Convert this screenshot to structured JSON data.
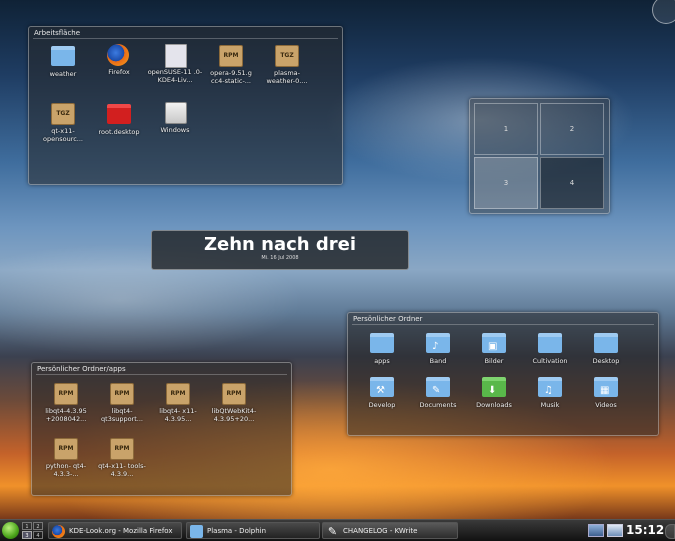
{
  "desktop_panel": {
    "title": "Arbeitsfläche",
    "icons": [
      {
        "label": "weather",
        "icon": "folder-icon"
      },
      {
        "label": "Firefox",
        "icon": "firefox-icon"
      },
      {
        "label": "openSUSE-11 .0-KDE4-Liv...",
        "icon": "cd-image-icon"
      },
      {
        "label": "opera-9.51.g cc4-static-...",
        "icon": "rpm-package-icon",
        "badge": "RPM"
      },
      {
        "label": "plasma- weather-0....",
        "icon": "tgz-archive-icon",
        "badge": "TGZ"
      },
      {
        "label": "qt-x11- opensourc...",
        "icon": "tgz-archive-icon",
        "badge": "TGZ"
      },
      {
        "label": "root.desktop",
        "icon": "red-folder-icon"
      },
      {
        "label": "Windows",
        "icon": "drive-icon"
      }
    ]
  },
  "pager": {
    "desktops": [
      "1",
      "2",
      "3",
      "4"
    ]
  },
  "clock": {
    "time": "Zehn nach drei",
    "date": "Mi. 16 Jul 2008"
  },
  "home_panel": {
    "title": "Persönlicher Ordner",
    "icons": [
      {
        "label": "apps"
      },
      {
        "label": "Band",
        "glyph": "♪"
      },
      {
        "label": "Bilder",
        "glyph": "▣"
      },
      {
        "label": "Cultivation"
      },
      {
        "label": "Desktop"
      },
      {
        "label": "Develop",
        "glyph": "⚒"
      },
      {
        "label": "Documents",
        "glyph": "✎"
      },
      {
        "label": "Downloads",
        "glyph": "⬇"
      },
      {
        "label": "Musik",
        "glyph": "♫"
      },
      {
        "label": "Videos",
        "glyph": "▦"
      }
    ]
  },
  "apps_panel": {
    "title": "Persönlicher Ordner/apps",
    "icons": [
      {
        "label": "libqt4-4.3.95 +2008042...",
        "badge": "RPM"
      },
      {
        "label": "libqt4- qt3support...",
        "badge": "RPM"
      },
      {
        "label": "libqt4- x11-4.3.95...",
        "badge": "RPM"
      },
      {
        "label": "libQtWebKit4- 4.3.95+20...",
        "badge": "RPM"
      },
      {
        "label": "python- qt4-4.3.3-...",
        "badge": "RPM"
      },
      {
        "label": "qt4-x11- tools-4.3.9...",
        "badge": "RPM"
      }
    ]
  },
  "taskbar": {
    "pager_labels": [
      "1",
      "2",
      "3",
      "4"
    ],
    "tasks": [
      {
        "label": "KDE-Look.org - Mozilla Firefox"
      },
      {
        "label": "Plasma - Dolphin"
      },
      {
        "label": "CHANGELOG - KWrite"
      }
    ],
    "time": "15:12"
  },
  "colors": {
    "accent": "#7ab6ea",
    "panel_bg": "#282828"
  }
}
